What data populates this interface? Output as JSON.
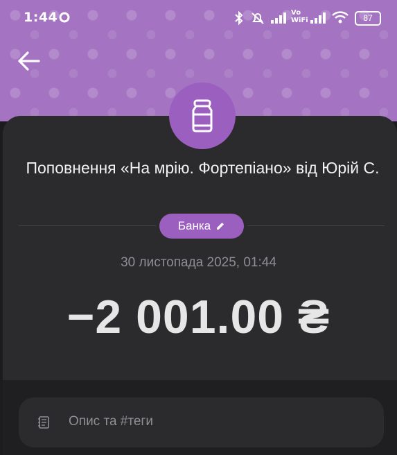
{
  "status_bar": {
    "time": "1:44",
    "network_label_top": "Vo",
    "network_label_bottom": "WiFi",
    "battery": "87"
  },
  "transaction": {
    "icon": "jar-icon",
    "title": "Поповнення «На мрію. Фортепіано» від Юрій С.",
    "category": "Банка",
    "date": "30 листопада 2025, 01:44",
    "amount": "−2 001.00 ₴"
  },
  "description_field": {
    "placeholder": "Опис та #теги"
  },
  "colors": {
    "header": "#a473c1",
    "accent": "#9b5fc0",
    "card": "#2b2b2d",
    "background": "#1c1c1e"
  }
}
